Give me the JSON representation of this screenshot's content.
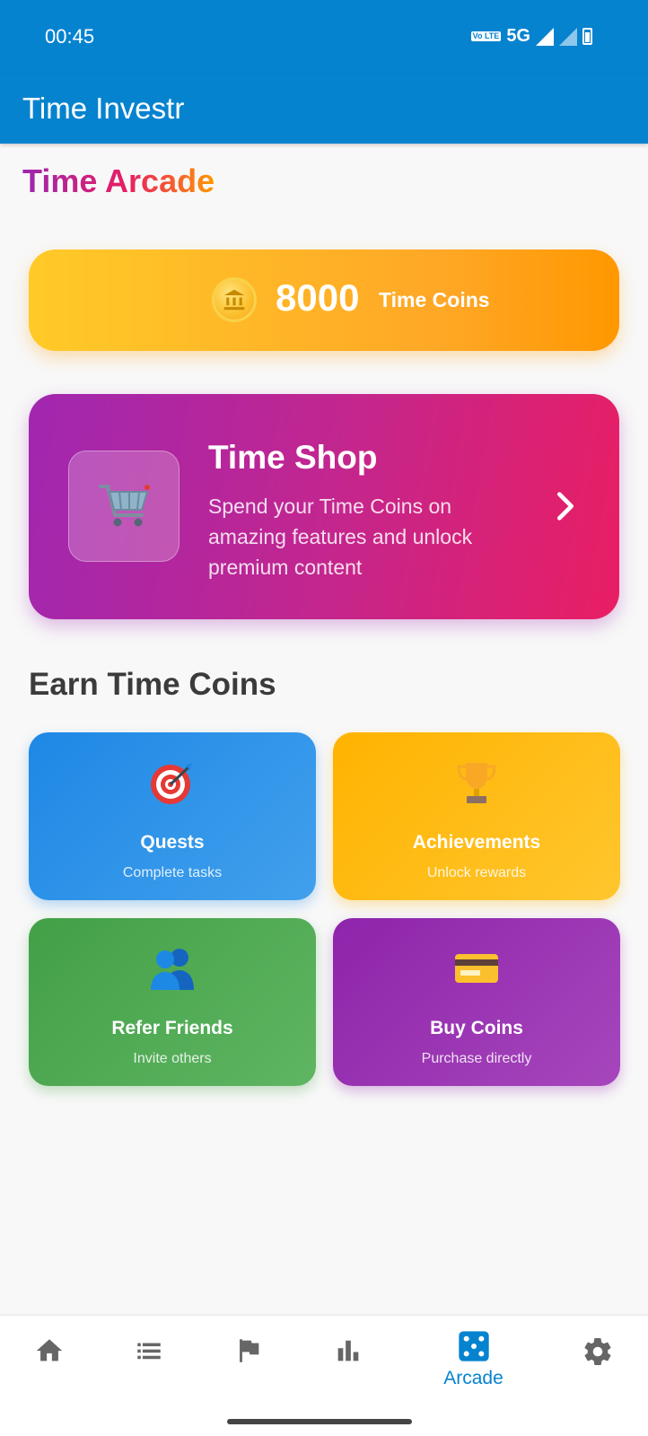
{
  "status_bar": {
    "time": "00:45",
    "network": "5G",
    "volte": "Vo LTE"
  },
  "app_bar": {
    "title": "Time Investr"
  },
  "page": {
    "heading": "Time Arcade"
  },
  "coins": {
    "amount": "8000",
    "unit": "Time Coins",
    "icon": "coin-bank-icon"
  },
  "shop": {
    "title": "Time Shop",
    "description": "Spend your Time Coins on amazing features and unlock premium content",
    "icon": "shopping-cart-icon"
  },
  "earn": {
    "title": "Earn Time Coins",
    "tiles": [
      {
        "title": "Quests",
        "subtitle": "Complete tasks",
        "icon": "target-icon",
        "color": "#1e88e5"
      },
      {
        "title": "Achievements",
        "subtitle": "Unlock rewards",
        "icon": "trophy-icon",
        "color": "#ffb300"
      },
      {
        "title": "Refer Friends",
        "subtitle": "Invite others",
        "icon": "people-icon",
        "color": "#43a047"
      },
      {
        "title": "Buy Coins",
        "subtitle": "Purchase directly",
        "icon": "credit-card-icon",
        "color": "#8e24aa"
      }
    ]
  },
  "bottom_nav": {
    "items": [
      {
        "icon": "home-icon"
      },
      {
        "icon": "list-icon"
      },
      {
        "icon": "flag-icon"
      },
      {
        "icon": "bar-chart-icon"
      },
      {
        "icon": "dice-icon",
        "label": "Arcade",
        "active": true
      },
      {
        "icon": "gear-icon"
      }
    ],
    "active_color": "#0683cf"
  },
  "colors": {
    "primary": "#0683cf",
    "background": "#f8f8f8"
  }
}
